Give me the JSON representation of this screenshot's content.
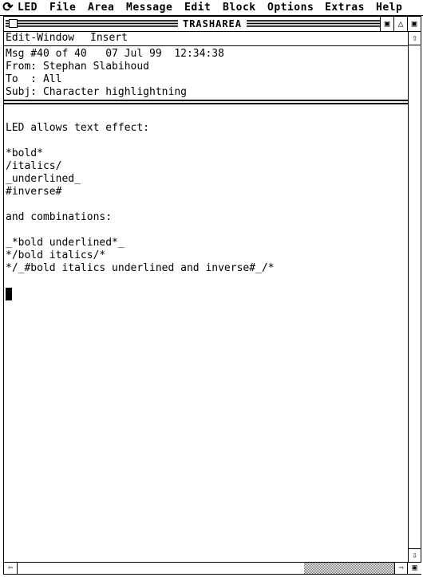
{
  "menubar": {
    "items": [
      "LED",
      "File",
      "Area",
      "Message",
      "Edit",
      "Block",
      "Options",
      "Extras",
      "Help"
    ]
  },
  "window": {
    "title": "TRASHAREA"
  },
  "modebar": {
    "window_label": "Edit-Window",
    "mode_label": "Insert"
  },
  "header": {
    "msg": "Msg #40 of 40   07 Jul 99  12:34:38",
    "from": "From: Stephan Slabihoud",
    "to": "To  : All",
    "subj": "Subj: Character highlightning"
  },
  "body": {
    "lines": [
      "LED allows text effect:",
      "*bold*",
      "/italics/",
      "_underlined_",
      "#inverse#",
      "and combinations:",
      "_*bold underlined*_",
      "*/bold italics/*",
      "*/_#bold italics underlined and inverse#_/*"
    ]
  },
  "icons": {
    "apple": "apple-menu-icon",
    "close": "close-box-icon",
    "fullbox": "full-box-icon",
    "iconify": "iconify-icon",
    "zoom": "zoom-box-icon",
    "up": "scroll-up-arrow-icon",
    "down": "scroll-down-arrow-icon",
    "left": "scroll-left-arrow-icon",
    "right": "scroll-right-arrow-icon",
    "grow": "size-box-icon"
  }
}
